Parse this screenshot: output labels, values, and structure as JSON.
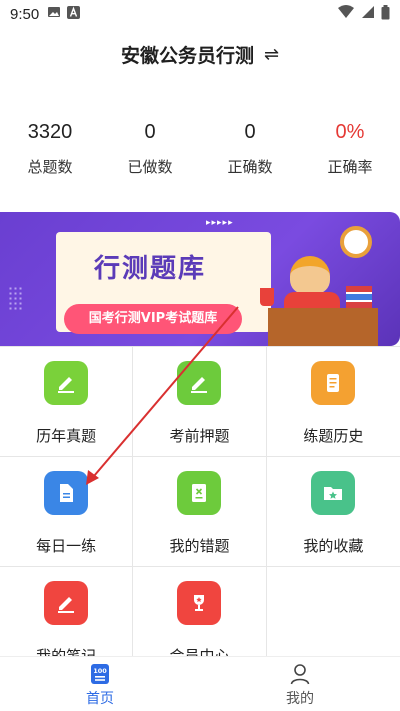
{
  "status_bar": {
    "time": "9:50",
    "icons": [
      "image-icon",
      "a-badge-icon"
    ],
    "right_icons": [
      "wifi-icon",
      "signal-icon",
      "battery-icon"
    ]
  },
  "header": {
    "title": "安徽公务员行测",
    "swap_icon": "⇌"
  },
  "stats": [
    {
      "value": "3320",
      "label": "总题数"
    },
    {
      "value": "0",
      "label": "已做数"
    },
    {
      "value": "0",
      "label": "正确数"
    },
    {
      "value": "0%",
      "label": "正确率"
    }
  ],
  "colors": {
    "accent_red": "#e53935",
    "nav_active": "#2d6be4",
    "banner_purple": "#6a3fd1"
  },
  "banner": {
    "title": "行测题库",
    "subtitle": "国考行测VIP考试题库",
    "arrows": "▸▸▸▸▸"
  },
  "grid": [
    {
      "label": "历年真题",
      "icon": "pen-icon",
      "color": "#7ad13a"
    },
    {
      "label": "考前押题",
      "icon": "pen-icon",
      "color": "#6dcb3c"
    },
    {
      "label": "练题历史",
      "icon": "document-icon",
      "color": "#f4a131"
    },
    {
      "label": "每日一练",
      "icon": "file-icon",
      "color": "#3a86e6"
    },
    {
      "label": "我的错题",
      "icon": "wrong-book-icon",
      "color": "#6dcb3c"
    },
    {
      "label": "我的收藏",
      "icon": "star-folder-icon",
      "color": "#49c28a"
    },
    {
      "label": "我的笔记",
      "icon": "pen-icon",
      "color": "#f0453f"
    },
    {
      "label": "会员中心",
      "icon": "trophy-icon",
      "color": "#f0453f"
    }
  ],
  "bottom_nav": [
    {
      "label": "首页",
      "icon": "home-100-icon",
      "active": true
    },
    {
      "label": "我的",
      "icon": "person-icon",
      "active": false
    }
  ],
  "home_icon_text": "100"
}
